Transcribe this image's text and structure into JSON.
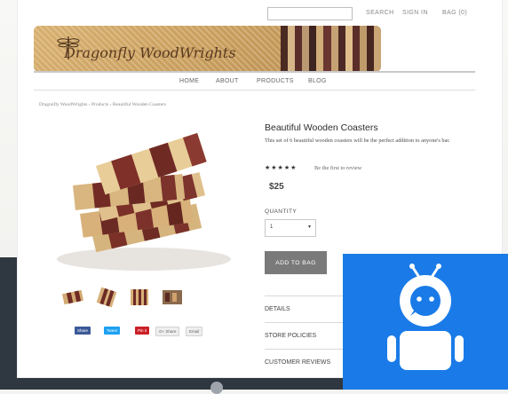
{
  "topbar": {
    "search_label": "SEARCH",
    "signin_label": "SIGN IN",
    "bag_label": "BAG (0)"
  },
  "brand": {
    "name": "Dragonfly WoodWrights"
  },
  "nav": {
    "items": [
      "HOME",
      "ABOUT",
      "PRODUCTS",
      "BLOG"
    ]
  },
  "breadcrumb": {
    "home": "Dragonfly WoodWrights",
    "sep1": "›",
    "section": "Products",
    "sep2": "›",
    "current": "Beautiful Wooden Coasters"
  },
  "product": {
    "title": "Beautiful Wooden Coasters",
    "description": "This set of 6 beautiful wooden coasters will be the perfect addition to anyone's bar.",
    "rating_stars": "★★★★★",
    "review_text": "Be the first to review",
    "price": "$25",
    "quantity_label": "QUANTITY",
    "quantity_value": "1",
    "add_button": "ADD TO BAG"
  },
  "accordion": {
    "details": "DETAILS",
    "policies": "STORE POLICIES",
    "reviews": "CUSTOMER REVIEWS"
  },
  "share": {
    "facebook": "Share",
    "twitter": "Tweet",
    "pinterest": "Pin it",
    "google": "G+ Share",
    "email": "Email"
  },
  "colors": {
    "banner": "#c99f5f",
    "button": "#7a7a7a",
    "robot_bg": "#1a7be8",
    "facebook": "#3b5998",
    "twitter": "#1da1f2",
    "pinterest": "#cb2027"
  },
  "icons": {
    "dragonfly": "dragonfly-icon",
    "robot": "robot-icon",
    "caret": "chevron-down-icon"
  }
}
